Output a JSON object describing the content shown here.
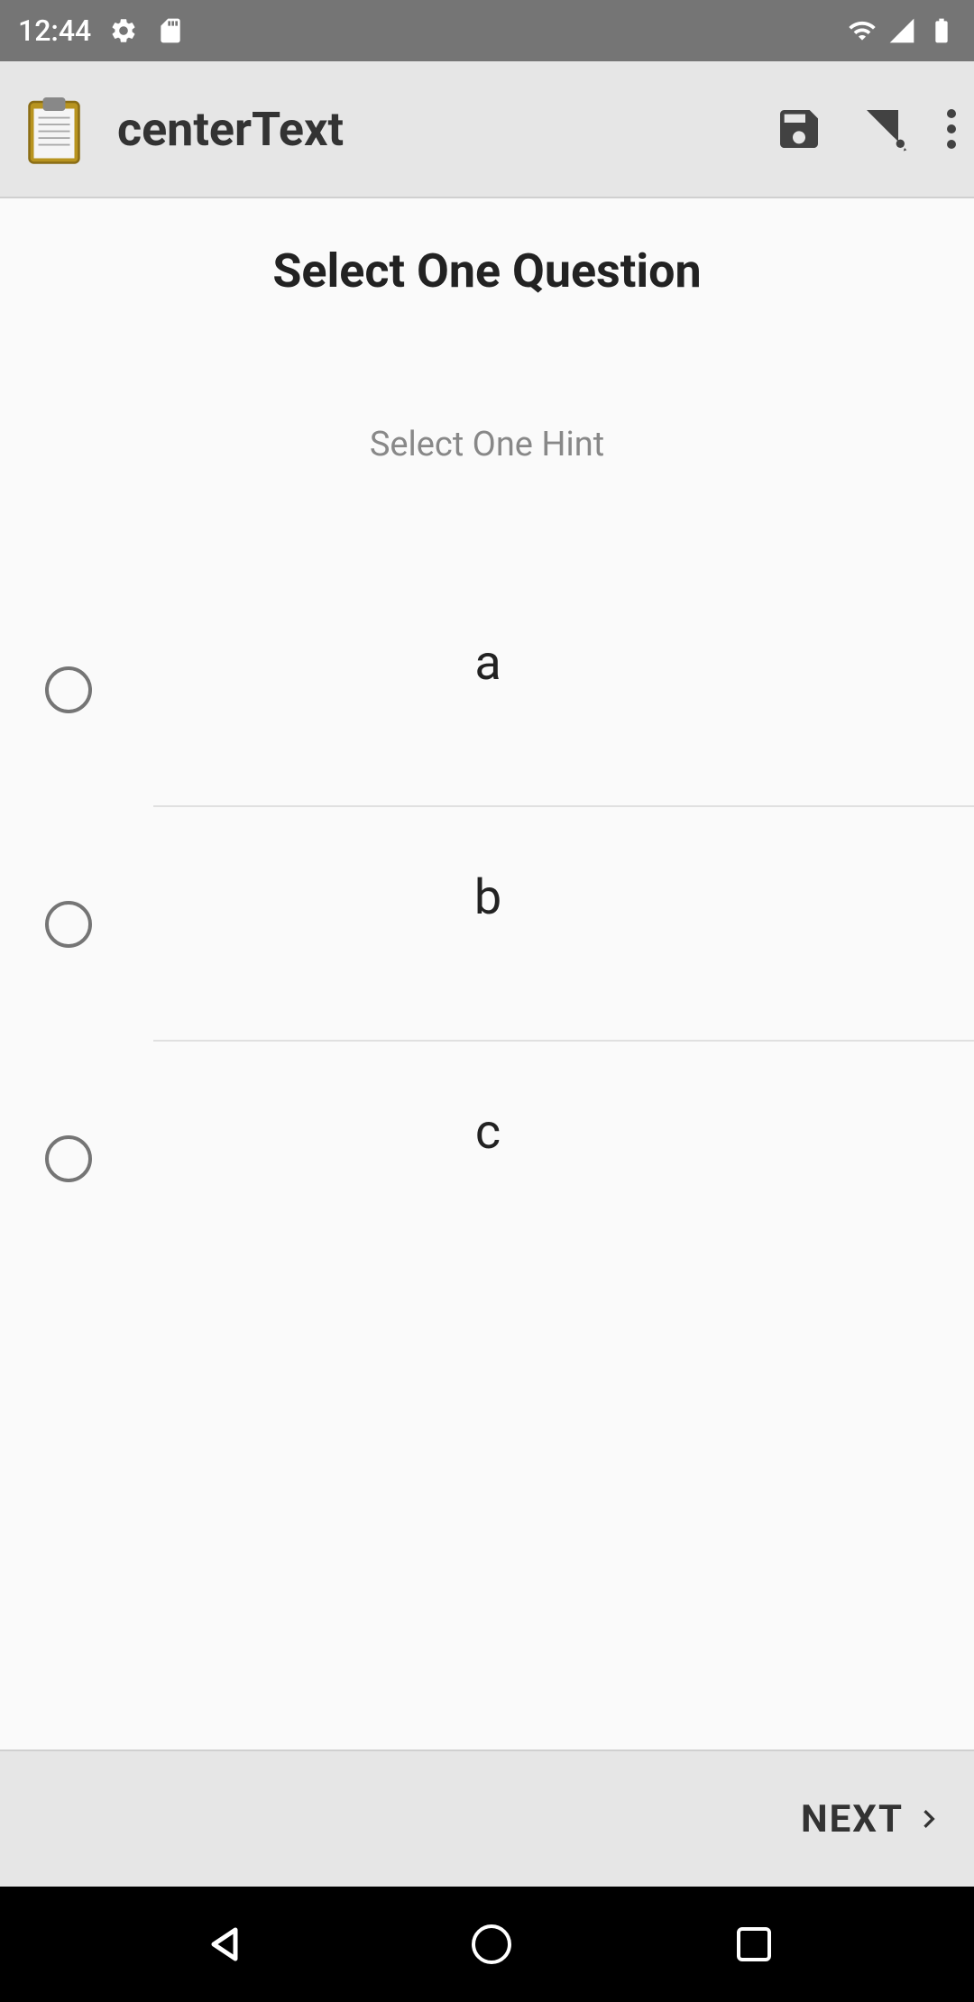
{
  "statusBar": {
    "time": "12:44"
  },
  "appBar": {
    "title": "centerText"
  },
  "content": {
    "questionTitle": "Select One Question",
    "hintText": "Select One Hint",
    "options": [
      {
        "label": "a"
      },
      {
        "label": "b"
      },
      {
        "label": "c"
      }
    ]
  },
  "footer": {
    "nextLabel": "NEXT"
  }
}
